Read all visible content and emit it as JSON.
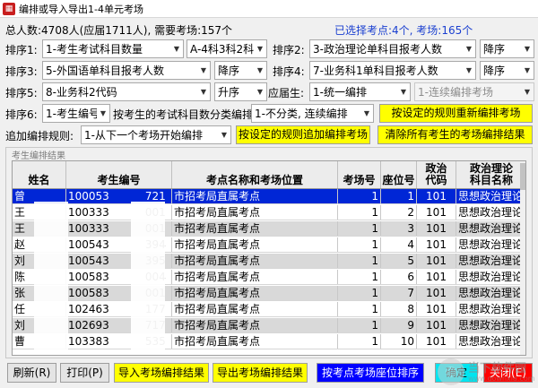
{
  "window": {
    "title": "编排或导入导出1-4单元考场"
  },
  "summary": {
    "total_text": "总人数:4708人(应届1711人), 需要考场:157个",
    "selected_text": "已选择考点:4个, 考场:165个"
  },
  "sort": {
    "label1": "排序1:",
    "field1": "1-考生考试科目数量",
    "order1": "A-4科3科2科",
    "label2": "排序2:",
    "field2": "3-政治理论单科目报考人数",
    "order2": "降序",
    "label3": "排序3:",
    "field3": "5-外国语单科目报考人数",
    "order3": "降序",
    "label4": "排序4:",
    "field4": "7-业务科1单科目报考人数",
    "order4": "降序",
    "label5": "排序5:",
    "field5": "8-业务科2代码",
    "order5": "升序",
    "fresh_label": "应届生:",
    "fresh_value": "1-统一编排",
    "fresh_extra": "1-连续编排考场",
    "label6": "排序6:",
    "field6": "1-考生编号",
    "classify_label": "按考生的考试科目数分类编排:",
    "classify_value": "1-不分类, 连续编排",
    "rebuild_button": "按设定的规则重新编排考场"
  },
  "append": {
    "label": "追加编排规则:",
    "value": "1-从下一个考场开始编排",
    "append_button": "按设定的规则追加编排考场",
    "clear_button": "清除所有考生的考场编排结果"
  },
  "panel": {
    "title": "考生编排结果"
  },
  "table": {
    "headers": [
      "姓名",
      "考生编号",
      "考点名称和考场位置",
      "考场号",
      "座位号",
      "政治\n代码",
      "政治理论\n科目名称"
    ],
    "rows": [
      {
        "name": "曾",
        "id": "100053",
        "id_tail": "721",
        "site": "市招考局直属考点",
        "room": "1",
        "seat": "1",
        "code": "101",
        "subject": "思想政治理论"
      },
      {
        "name": "王",
        "id": "100333",
        "id_tail": "001",
        "site": "市招考局直属考点",
        "room": "1",
        "seat": "2",
        "code": "101",
        "subject": "思想政治理论"
      },
      {
        "name": "王",
        "id": "100333",
        "id_tail": "001",
        "site": "市招考局直属考点",
        "room": "1",
        "seat": "3",
        "code": "101",
        "subject": "思想政治理论"
      },
      {
        "name": "赵",
        "id": "100543",
        "id_tail": "394",
        "site": "市招考局直属考点",
        "room": "1",
        "seat": "4",
        "code": "101",
        "subject": "思想政治理论"
      },
      {
        "name": "刘",
        "id": "100543",
        "id_tail": "395",
        "site": "市招考局直属考点",
        "room": "1",
        "seat": "5",
        "code": "101",
        "subject": "思想政治理论"
      },
      {
        "name": "陈",
        "id": "100583",
        "id_tail": "004",
        "site": "市招考局直属考点",
        "room": "1",
        "seat": "6",
        "code": "101",
        "subject": "思想政治理论"
      },
      {
        "name": "张",
        "id": "100583",
        "id_tail": "001",
        "site": "市招考局直属考点",
        "room": "1",
        "seat": "7",
        "code": "101",
        "subject": "思想政治理论"
      },
      {
        "name": "任",
        "id": "102463",
        "id_tail": "177",
        "site": "市招考局直属考点",
        "room": "1",
        "seat": "8",
        "code": "101",
        "subject": "思想政治理论"
      },
      {
        "name": "刘",
        "id": "102693",
        "id_tail": "717",
        "site": "市招考局直属考点",
        "room": "1",
        "seat": "9",
        "code": "101",
        "subject": "思想政治理论"
      },
      {
        "name": "曹",
        "id": "103383",
        "id_tail": "535",
        "site": "市招考局直属考点",
        "room": "1",
        "seat": "10",
        "code": "101",
        "subject": "思想政治理论"
      }
    ]
  },
  "buttons": {
    "refresh": "刷新(R)",
    "print": "打印(P)",
    "import": "导入考场编排结果",
    "export": "导出考场编排结果",
    "seat_sort": "按考点考场座位排序",
    "ok": "确定",
    "close": "关闭(E)"
  },
  "watermark": {
    "text": "当下软件园",
    "url": "www.downxia.com"
  },
  "colors": {
    "selected_row": "#0026d6",
    "highlight_button": "#ffff00",
    "primary_button": "#0000ff",
    "close_button": "#ff0000",
    "ok_button": "#00e5f0"
  }
}
